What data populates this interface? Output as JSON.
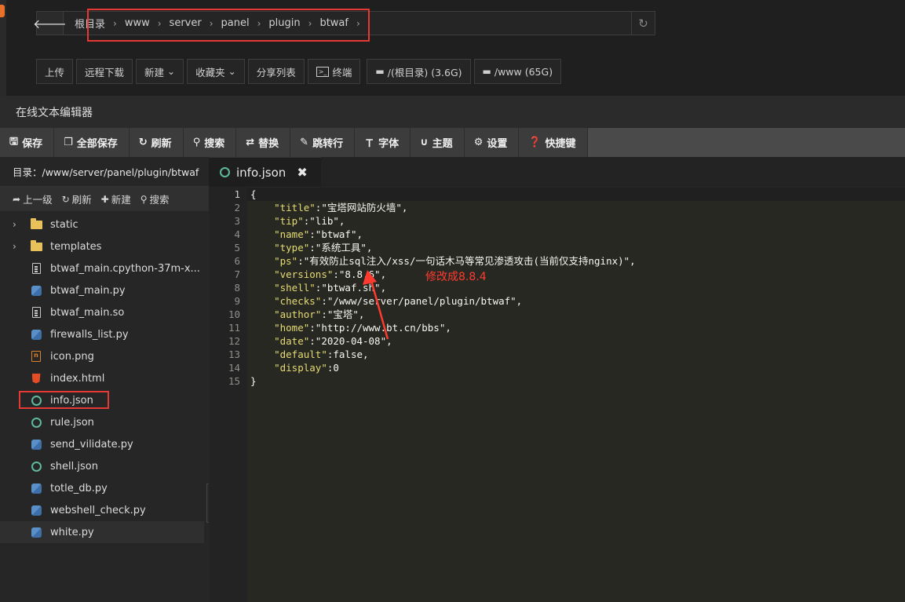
{
  "breadcrumb": [
    "根目录",
    "www",
    "server",
    "panel",
    "plugin",
    "btwaf"
  ],
  "toolbar": {
    "upload": "上传",
    "remote_download": "远程下载",
    "new": "新建",
    "favorites": "收藏夹",
    "share_list": "分享列表",
    "terminal": "终端",
    "disk_root": "/(根目录) (3.6G)",
    "disk_www": "/www (65G)"
  },
  "editor": {
    "title": "在线文本编辑器",
    "buttons": [
      "保存",
      "全部保存",
      "刷新",
      "搜索",
      "替换",
      "跳转行",
      "字体",
      "主题",
      "设置",
      "快捷键"
    ],
    "directory": "目录：/www/server/panel/plugin/btwaf",
    "dir_tools": [
      "上一级",
      "刷新",
      "新建",
      "搜索"
    ],
    "tab_name": "info.json",
    "tab_close": "✖"
  },
  "files": [
    {
      "name": "static",
      "type": "folder"
    },
    {
      "name": "templates",
      "type": "folder"
    },
    {
      "name": "btwaf_main.cpython-37m-x...",
      "type": "doc"
    },
    {
      "name": "btwaf_main.py",
      "type": "py"
    },
    {
      "name": "btwaf_main.so",
      "type": "doc"
    },
    {
      "name": "firewalls_list.py",
      "type": "py"
    },
    {
      "name": "icon.png",
      "type": "img"
    },
    {
      "name": "index.html",
      "type": "html"
    },
    {
      "name": "info.json",
      "type": "json"
    },
    {
      "name": "rule.json",
      "type": "json"
    },
    {
      "name": "send_vilidate.py",
      "type": "py"
    },
    {
      "name": "shell.json",
      "type": "json"
    },
    {
      "name": "totle_db.py",
      "type": "py"
    },
    {
      "name": "webshell_check.py",
      "type": "py"
    },
    {
      "name": "white.py",
      "type": "py"
    }
  ],
  "code_lines": [
    "{",
    "    \"title\":\"宝塔网站防火墙\",",
    "    \"tip\":\"lib\",",
    "    \"name\":\"btwaf\",",
    "    \"type\":\"系统工具\",",
    "    \"ps\":\"有效防止sql注入/xss/一句话木马等常见渗透攻击(当前仅支持nginx)\",",
    "    \"versions\":\"8.8.6\",",
    "    \"shell\":\"btwaf.sh\",",
    "    \"checks\":\"/www/server/panel/plugin/btwaf\",",
    "    \"author\":\"宝塔\",",
    "    \"home\":\"http://www.bt.cn/bbs\",",
    "    \"date\":\"2020-04-08\",",
    "    \"default\":false,",
    "    \"display\":0",
    "}"
  ],
  "line_numbers": [
    "1",
    "2",
    "3",
    "4",
    "5",
    "6",
    "7",
    "8",
    "9",
    "10",
    "11",
    "12",
    "13",
    "14",
    "15"
  ],
  "annotation": "修改成8.8.4",
  "colors": {
    "highlight_box": "#e53935",
    "annotation": "#ff3b30"
  }
}
